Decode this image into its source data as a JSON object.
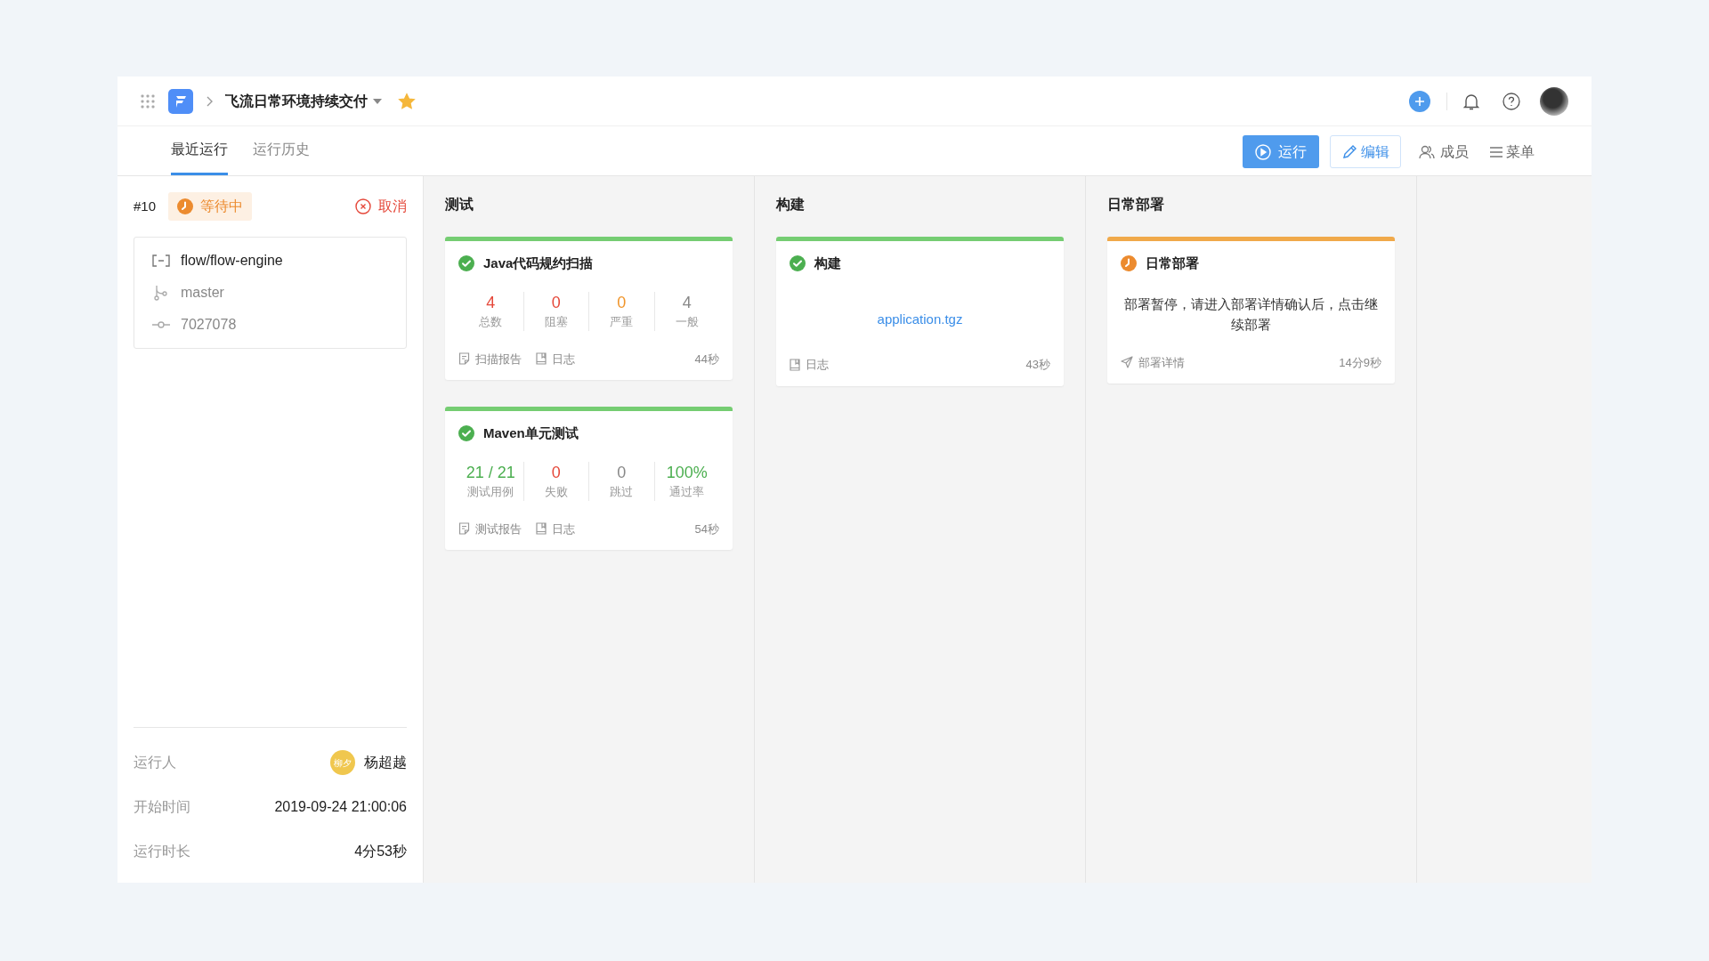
{
  "header": {
    "project": "飞流日常环境持续交付",
    "starred": true
  },
  "tabs": [
    {
      "label": "最近运行",
      "selected": true
    },
    {
      "label": "运行历史",
      "selected": false
    }
  ],
  "actions": {
    "run": "运行",
    "edit": "编辑",
    "members": "成员",
    "menu": "菜单"
  },
  "run": {
    "number": "#10",
    "status": {
      "kind": "waiting",
      "label": "等待中"
    },
    "cancel": "取消",
    "repo": "flow/flow-engine",
    "branch": "master",
    "commit": "7027078",
    "details": [
      {
        "label": "运行人",
        "value": "杨超越",
        "avatar": "柳夕"
      },
      {
        "label": "开始时间",
        "value": "2019-09-24 21:00:06"
      },
      {
        "label": "运行时长",
        "value": "4分53秒"
      }
    ]
  },
  "stages": [
    {
      "title": "测试",
      "cards": [
        {
          "kind": "stats",
          "done": true,
          "title": "Java代码规约扫描",
          "stats": [
            {
              "value": "4",
              "label": "总数",
              "color": "#e5483a"
            },
            {
              "value": "0",
              "label": "阻塞",
              "color": "#e5483a"
            },
            {
              "value": "0",
              "label": "严重",
              "color": "#f0952b"
            },
            {
              "value": "4",
              "label": "一般",
              "color": "#888888"
            }
          ],
          "links": [
            {
              "kind": "report",
              "label": "扫描报告"
            },
            {
              "kind": "log",
              "label": "日志"
            }
          ],
          "duration": "44秒"
        },
        {
          "kind": "stats",
          "done": true,
          "title": "Maven单元测试",
          "stats": [
            {
              "value": "21 / 21",
              "label": "测试用例",
              "color": "#4caf50"
            },
            {
              "value": "0",
              "label": "失败",
              "color": "#e5483a"
            },
            {
              "value": "0",
              "label": "跳过",
              "color": "#888888"
            },
            {
              "value": "100%",
              "label": "通过率",
              "color": "#4caf50"
            }
          ],
          "links": [
            {
              "kind": "report",
              "label": "测试报告"
            },
            {
              "kind": "log",
              "label": "日志"
            }
          ],
          "duration": "54秒"
        }
      ]
    },
    {
      "title": "构建",
      "cards": [
        {
          "kind": "artifact",
          "done": true,
          "title": "构建",
          "artifact": "application.tgz",
          "links": [
            {
              "kind": "log",
              "label": "日志"
            }
          ],
          "duration": "43秒"
        }
      ]
    },
    {
      "title": "日常部署",
      "cards": [
        {
          "kind": "message",
          "done": false,
          "title": "日常部署",
          "message": "部署暂停，请进入部署详情确认后，点击继续部署",
          "links": [
            {
              "kind": "send",
              "label": "部署详情"
            }
          ],
          "duration": "14分9秒"
        }
      ]
    }
  ]
}
